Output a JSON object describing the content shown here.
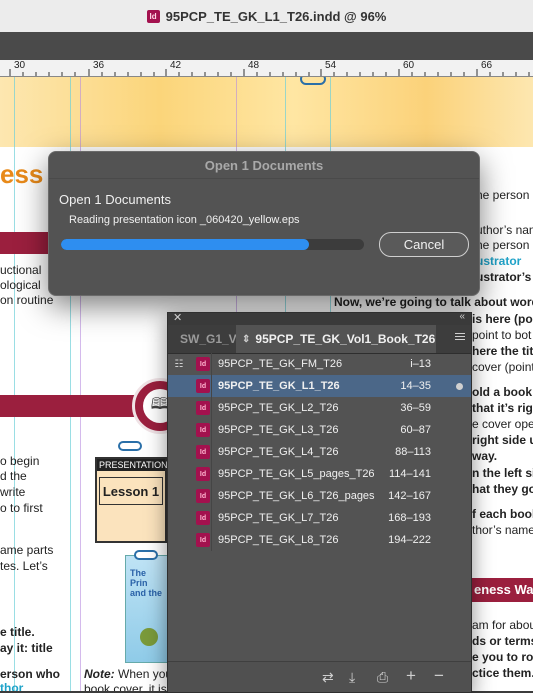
{
  "window": {
    "title": "95PCP_TE_GK_L1_T26.indd @ 96%",
    "app_badge": "Id"
  },
  "ruler": {
    "ticks": [
      "30",
      "36",
      "42",
      "48",
      "54",
      "60",
      "66"
    ]
  },
  "document": {
    "heading_fragment": "ess",
    "left_column": [
      "uctional",
      "ological",
      "on routine",
      "o begin",
      "d the",
      "write",
      "o to first",
      "ame parts",
      "tes. Let’s",
      "e title.",
      "ay it: title",
      "erson who",
      "thor"
    ],
    "right_column": [
      "he person",
      "uthor’s nam",
      "he person",
      "ustrator",
      "ustrator’s",
      "Now, we’re going to talk about words",
      "is here (point",
      "point to bot",
      "here the title",
      "cover (point",
      "old a book",
      "that it’s rig",
      "e cover ope",
      "right side u",
      "way.",
      "n the left si",
      "hat they go",
      "f each book",
      "thor’s name,",
      "eness Wa",
      "am for abou",
      "ds or terms",
      "e you to rou",
      "ctice them."
    ],
    "presentation_label": "PRESENTATION",
    "lesson_label": "Lesson 1",
    "book_title_fragment": "The Prin and the",
    "note_label": "Note:",
    "note_text": "When you",
    "note_text2": "book cover, it is"
  },
  "dialog": {
    "title": "Open 1 Documents",
    "heading": "Open 1 Documents",
    "status": "Reading presentation icon _060420_yellow.eps",
    "progress": 0.82,
    "cancel_label": "Cancel"
  },
  "book_panel": {
    "tabs": [
      {
        "label": "SW_G1_Vo",
        "active": false
      },
      {
        "label": "95PCP_TE_GK_Vol1_Book_T26",
        "active": true
      }
    ],
    "rows": [
      {
        "name": "95PCP_TE_GK_FM_T26",
        "pages": "i–13",
        "selected": false,
        "style_source": true
      },
      {
        "name": "95PCP_TE_GK_L1_T26",
        "pages": "14–35",
        "selected": true,
        "open": true
      },
      {
        "name": "95PCP_TE_GK_L2_T26",
        "pages": "36–59",
        "selected": false
      },
      {
        "name": "95PCP_TE_GK_L3_T26",
        "pages": "60–87",
        "selected": false
      },
      {
        "name": "95PCP_TE_GK_L4_T26",
        "pages": "88–113",
        "selected": false
      },
      {
        "name": "95PCP_TE_GK_L5_pages_T26",
        "pages": "114–141",
        "selected": false
      },
      {
        "name": "95PCP_TE_GK_L6_T26_pages",
        "pages": "142–167",
        "selected": false
      },
      {
        "name": "95PCP_TE_GK_L7_T26",
        "pages": "168–193",
        "selected": false
      },
      {
        "name": "95PCP_TE_GK_L8_T26",
        "pages": "194–222",
        "selected": false
      }
    ],
    "footer_icons": [
      "synchronize-icon",
      "save-book-icon",
      "print-book-icon",
      "add-document-icon",
      "remove-document-icon"
    ]
  },
  "colors": {
    "accent": "#2e8ef0",
    "selection": "#4b6788",
    "indesign_badge": "#a3114e",
    "crimson_rule": "#9b1f3e",
    "banner": "#fbd57a",
    "link_cyan": "#1fa3c9"
  }
}
